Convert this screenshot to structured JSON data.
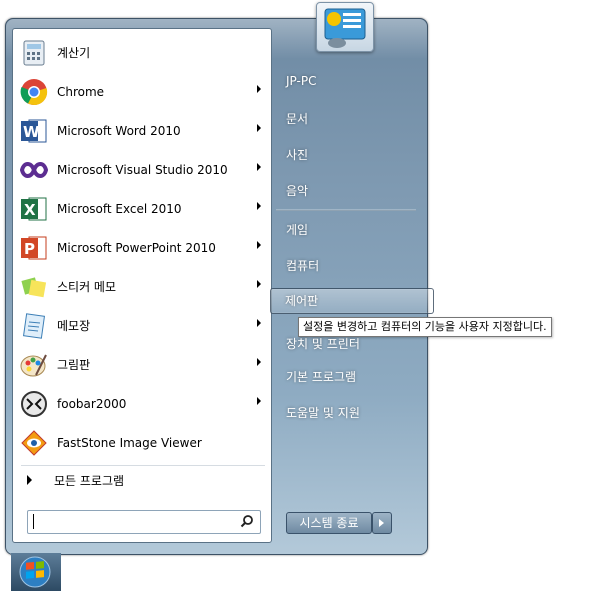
{
  "programs": [
    {
      "label": "계산기",
      "icon": "calculator-icon",
      "submenu": false
    },
    {
      "label": "Chrome",
      "icon": "chrome-icon",
      "submenu": true
    },
    {
      "label": "Microsoft Word 2010",
      "icon": "word-icon",
      "submenu": true
    },
    {
      "label": "Microsoft Visual Studio 2010",
      "icon": "visual-studio-icon",
      "submenu": true
    },
    {
      "label": "Microsoft Excel 2010",
      "icon": "excel-icon",
      "submenu": true
    },
    {
      "label": "Microsoft PowerPoint 2010",
      "icon": "powerpoint-icon",
      "submenu": true
    },
    {
      "label": "스티커 메모",
      "icon": "sticky-notes-icon",
      "submenu": true
    },
    {
      "label": "메모장",
      "icon": "notepad-icon",
      "submenu": true
    },
    {
      "label": "그림판",
      "icon": "paint-icon",
      "submenu": true
    },
    {
      "label": "foobar2000",
      "icon": "foobar-icon",
      "submenu": true
    },
    {
      "label": "FastStone Image Viewer",
      "icon": "faststone-icon",
      "submenu": false
    }
  ],
  "all_programs_label": "모든 프로그램",
  "search": {
    "value": "",
    "placeholder": ""
  },
  "right_pane": {
    "items": [
      {
        "label": "JP-PC"
      },
      {
        "label": "문서"
      },
      {
        "label": "사진"
      },
      {
        "label": "음악"
      },
      {
        "label": "게임"
      },
      {
        "label": "컴퓨터"
      },
      {
        "label": "제어판"
      },
      {
        "label": "장치 및 프린터"
      },
      {
        "label": "기본 프로그램"
      },
      {
        "label": "도움말 및 지원"
      }
    ]
  },
  "tooltip": "설정을 변경하고 컴퓨터의 기능을 사용자 지정합니다.",
  "shutdown_label": "시스템 종료",
  "colors": {
    "frame": "#7e99b1",
    "accent": "#1e88e5"
  }
}
